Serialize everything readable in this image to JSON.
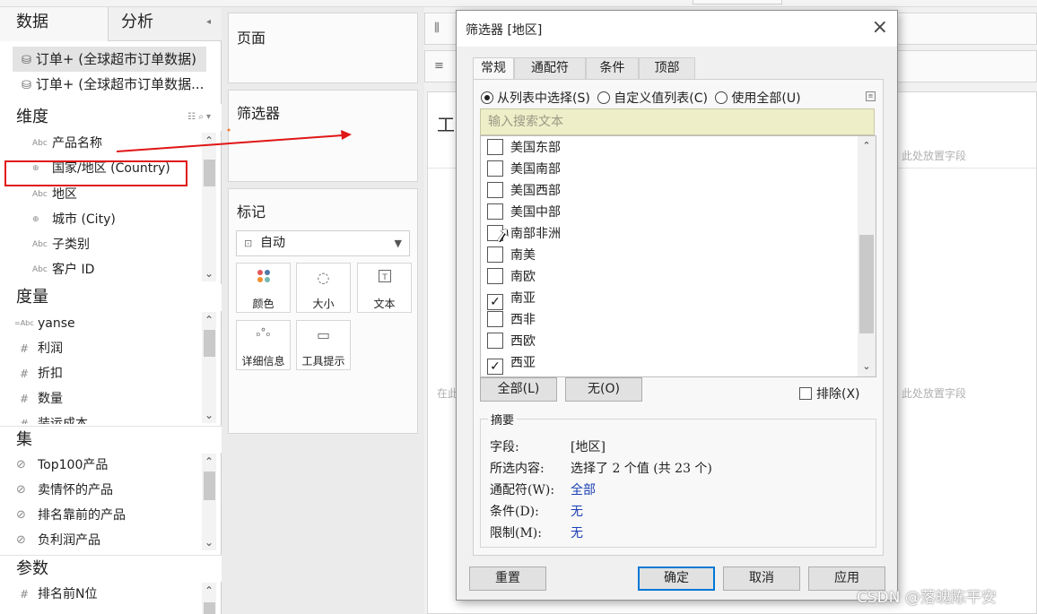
{
  "data_pane": {
    "tabs": [
      "数据",
      "分析"
    ],
    "datasources": [
      "订单+ (全球超市订单数据)",
      "订单+ (全球超市订单数据..."
    ],
    "dimensions": {
      "title": "维度",
      "fields": [
        {
          "label": "产品名称",
          "icon": "Abc"
        },
        {
          "label": "国家/地区 (Country)",
          "icon": "⊕"
        },
        {
          "label": "地区",
          "icon": "Abc"
        },
        {
          "label": "城市 (City)",
          "icon": "⊕"
        },
        {
          "label": "子类别",
          "icon": "Abc"
        },
        {
          "label": "客户 ID",
          "icon": "Abc"
        }
      ]
    },
    "measures": {
      "title": "度量",
      "fields": [
        {
          "label": "yanse",
          "icon": "=Abc"
        },
        {
          "label": "利润",
          "icon": "#"
        },
        {
          "label": "折扣",
          "icon": "#"
        },
        {
          "label": "数量",
          "icon": "#"
        },
        {
          "label": "装运成本",
          "icon": "#"
        }
      ]
    },
    "sets": {
      "title": "集",
      "fields": [
        {
          "label": "Top100产品",
          "icon": "⊘"
        },
        {
          "label": "卖情怀的产品",
          "icon": "⊘"
        },
        {
          "label": "排名靠前的产品",
          "icon": "⊘"
        },
        {
          "label": "负利润产品",
          "icon": "⊘"
        }
      ]
    },
    "params": {
      "title": "参数",
      "fields": [
        {
          "label": "排名前N位",
          "icon": "#"
        }
      ]
    }
  },
  "cards": {
    "pages": "页面",
    "filters": "筛选器",
    "marks": {
      "title": "标记",
      "type": "自动",
      "buttons": [
        {
          "label": "颜色",
          "icon": "color-icon"
        },
        {
          "label": "大小",
          "icon": "size-icon"
        },
        {
          "label": "文本",
          "icon": "text-icon"
        },
        {
          "label": "详细信息",
          "icon": "detail-icon"
        },
        {
          "label": "工具提示",
          "icon": "tooltip-icon"
        }
      ]
    }
  },
  "viz": {
    "title_fragment": "工",
    "drop_hint": "此处放置字段",
    "drop_hint_left": "在此"
  },
  "dialog": {
    "title": "筛选器 [地区]",
    "tabs": [
      "常规",
      "通配符",
      "条件",
      "顶部"
    ],
    "radio_options": [
      "从列表中选择(S)",
      "自定义值列表(C)",
      "使用全部(U)"
    ],
    "search_placeholder": "输入搜索文本",
    "list_items": [
      {
        "label": "美国东部",
        "checked": false
      },
      {
        "label": "美国南部",
        "checked": false
      },
      {
        "label": "美国西部",
        "checked": false
      },
      {
        "label": "美国中部",
        "checked": false
      },
      {
        "label": "南部非洲",
        "checked": false
      },
      {
        "label": "南美",
        "checked": false
      },
      {
        "label": "南欧",
        "checked": false
      },
      {
        "label": "南亚",
        "checked": true
      },
      {
        "label": "西非",
        "checked": false
      },
      {
        "label": "西欧",
        "checked": false
      },
      {
        "label": "西亚",
        "checked": true
      }
    ],
    "all_button": "全部(L)",
    "none_button": "无(O)",
    "exclude_label": "排除(X)",
    "summary": {
      "legend": "摘要",
      "rows": [
        {
          "key": "字段:",
          "value": "[地区]"
        },
        {
          "key": "所选内容:",
          "value": "选择了 2 个值 (共 23 个)"
        },
        {
          "key": "通配符(W):",
          "value": "全部"
        },
        {
          "key": "条件(D):",
          "value": "无"
        },
        {
          "key": "限制(M):",
          "value": "无"
        }
      ]
    },
    "footer_buttons": [
      "重置",
      "确定",
      "取消",
      "应用"
    ]
  },
  "watermark": "CSDN @落魄陈平安",
  "colors": {
    "highlight": "#e01515",
    "search_bg": "#eeeec8",
    "link": "#1a3fb3",
    "primary_border": "#0078d7"
  }
}
